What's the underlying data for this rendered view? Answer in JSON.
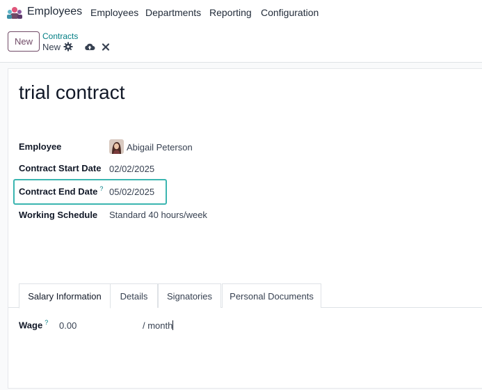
{
  "nav": {
    "app_name": "Employees",
    "menu": [
      "Employees",
      "Departments",
      "Reporting",
      "Configuration"
    ]
  },
  "control": {
    "new_button": "New",
    "breadcrumb_parent": "Contracts",
    "breadcrumb_current": "New",
    "icons": [
      "gear-icon",
      "cloud-upload-icon",
      "discard-icon"
    ]
  },
  "form": {
    "title": "trial contract",
    "fields": {
      "employee": {
        "label": "Employee",
        "value": "Abigail Peterson"
      },
      "start_date": {
        "label": "Contract Start Date",
        "value": "02/02/2025"
      },
      "end_date": {
        "label": "Contract End Date",
        "value": "05/02/2025",
        "help": "?"
      },
      "schedule": {
        "label": "Working Schedule",
        "value": "Standard 40 hours/week"
      }
    },
    "tabs": [
      "Salary Information",
      "Details",
      "Signatories",
      "Personal Documents"
    ],
    "active_tab": "Salary Information",
    "wage": {
      "label": "Wage",
      "help": "?",
      "value": "0.00",
      "unit": "/ month"
    }
  },
  "colors": {
    "brand": "#714b67",
    "link": "#017e84",
    "highlight": "#3ab5b0"
  }
}
